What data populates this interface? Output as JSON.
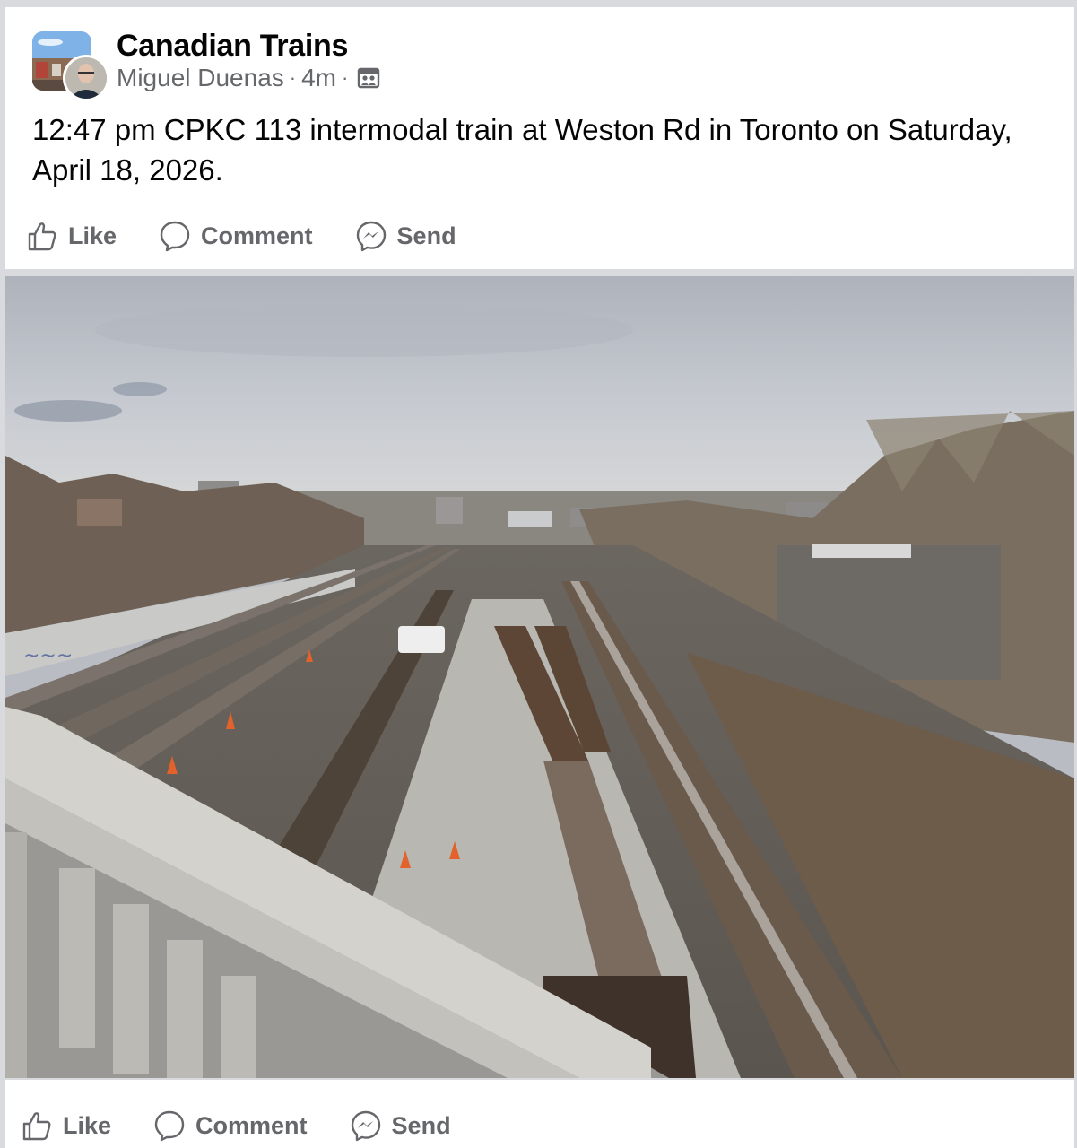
{
  "post": {
    "group_name": "Canadian Trains",
    "author": "Miguel Duenas",
    "separator": "·",
    "time": "4m",
    "privacy_icon": "group-members-icon",
    "text": "12:47 pm CPKC 113 intermodal train at Weston Rd in Toronto on Saturday, April 18, 2026."
  },
  "actions": {
    "like": "Like",
    "comment": "Comment",
    "send": "Send"
  },
  "colors": {
    "background": "#d9dadd",
    "card": "#ffffff",
    "text": "#050505",
    "secondary_text": "#65676b"
  }
}
